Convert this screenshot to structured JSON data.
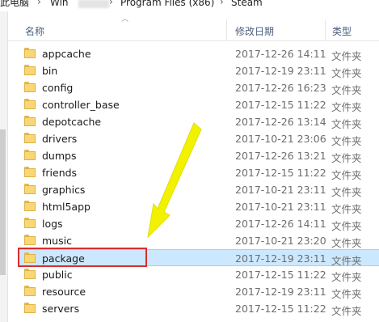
{
  "breadcrumb": {
    "segments": [
      "此电脑",
      "Win",
      "Program Files (x86)",
      "Steam"
    ],
    "separator": "›"
  },
  "columns": {
    "name": "名称",
    "date": "修改日期",
    "type": "类型"
  },
  "files": [
    {
      "name": "appcache",
      "date": "2017-12-26 14:11",
      "type": "文件夹"
    },
    {
      "name": "bin",
      "date": "2017-12-19 23:11",
      "type": "文件夹"
    },
    {
      "name": "config",
      "date": "2017-12-26 16:23",
      "type": "文件夹"
    },
    {
      "name": "controller_base",
      "date": "2017-12-15 11:22",
      "type": "文件夹"
    },
    {
      "name": "depotcache",
      "date": "2017-12-26 13:14",
      "type": "文件夹"
    },
    {
      "name": "drivers",
      "date": "2017-10-21 23:06",
      "type": "文件夹"
    },
    {
      "name": "dumps",
      "date": "2017-12-26 13:21",
      "type": "文件夹"
    },
    {
      "name": "friends",
      "date": "2017-12-15 11:22",
      "type": "文件夹"
    },
    {
      "name": "graphics",
      "date": "2017-10-21 23:11",
      "type": "文件夹"
    },
    {
      "name": "html5app",
      "date": "2017-10-21 23:11",
      "type": "文件夹"
    },
    {
      "name": "logs",
      "date": "2017-12-26 14:11",
      "type": "文件夹"
    },
    {
      "name": "music",
      "date": "2017-10-21 23:20",
      "type": "文件夹"
    },
    {
      "name": "package",
      "date": "2017-12-19 23:11",
      "type": "文件夹",
      "selected": true
    },
    {
      "name": "public",
      "date": "2017-12-15 11:22",
      "type": "文件夹"
    },
    {
      "name": "resource",
      "date": "2017-12-19 23:11",
      "type": "文件夹"
    },
    {
      "name": "servers",
      "date": "2017-12-15 11:22",
      "type": "文件夹"
    }
  ],
  "colors": {
    "folder": "#f8d775",
    "selection": "#cce8ff",
    "highlight": "#d62f2f",
    "arrow": "#f2f200"
  }
}
